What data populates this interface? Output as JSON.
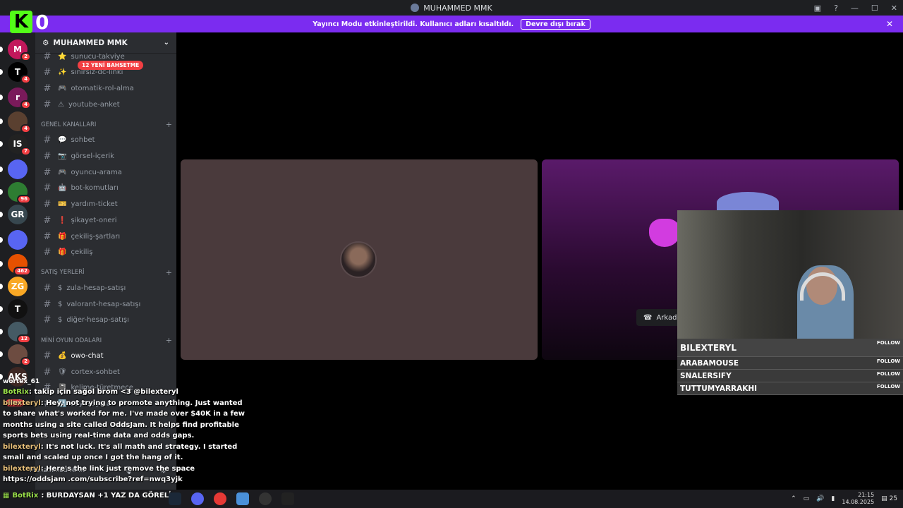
{
  "window": {
    "title": "MUHAMMED MMK"
  },
  "logo": {
    "letter": "K",
    "counter": "0"
  },
  "banner": {
    "message": "Yayıncı Modu etkinleştirildi. Kullanıcı adları kısaltıldı.",
    "button": "Devre dışı bırak"
  },
  "guilds": [
    {
      "label": "M",
      "badge": "2",
      "color": "#c2185b"
    },
    {
      "label": "T",
      "badge": "4",
      "color": "#000000"
    },
    {
      "label": "r",
      "badge": "4",
      "color": "#7a1a5a"
    },
    {
      "label": "",
      "badge": "4",
      "color": "#5a4030"
    },
    {
      "label": "IS",
      "badge": "7",
      "color": "#222222"
    },
    {
      "label": "",
      "badge": "",
      "color": "#5865f2"
    },
    {
      "label": "",
      "badge": "96",
      "color": "#2e7d32"
    },
    {
      "label": "GR",
      "badge": "",
      "color": "#37474f"
    },
    {
      "label": "",
      "badge": "",
      "color": "#5865f2"
    },
    {
      "label": "",
      "badge": "462",
      "color": "#e65100"
    },
    {
      "label": "ZG",
      "badge": "",
      "color": "#f9a825"
    },
    {
      "label": "T",
      "badge": "",
      "color": "#111111"
    },
    {
      "label": "",
      "badge": "12",
      "color": "#455a64"
    },
    {
      "label": "",
      "badge": "2",
      "color": "#6d4c41"
    },
    {
      "label": "AKS",
      "badge": "",
      "color": "#3e2723"
    }
  ],
  "server": {
    "name": "MUHAMMED MMK"
  },
  "new_pill": "12 YENİ BAHSETME",
  "channels": [
    {
      "type": "ch",
      "name": "sunucu-takviye",
      "emoji": "⭐"
    },
    {
      "type": "ch",
      "name": "sınırsız-dc-linki",
      "emoji": "✨"
    },
    {
      "type": "ch",
      "name": "otomatik-rol-alma",
      "emoji": "🎮"
    },
    {
      "type": "ch",
      "name": "youtube-anket",
      "emoji": "⚠"
    },
    {
      "type": "cat",
      "name": "GENEL KANALLARI"
    },
    {
      "type": "ch",
      "name": "sohbet",
      "emoji": "💬"
    },
    {
      "type": "ch",
      "name": "görsel-içerik",
      "emoji": "📷"
    },
    {
      "type": "ch",
      "name": "oyuncu-arama",
      "emoji": "🎮"
    },
    {
      "type": "ch",
      "name": "bot-komutları",
      "emoji": "🤖"
    },
    {
      "type": "ch",
      "name": "yardım-ticket",
      "emoji": "🎫"
    },
    {
      "type": "ch",
      "name": "şikayet-oneri",
      "emoji": "❗"
    },
    {
      "type": "ch",
      "name": "çekiliş-şartları",
      "emoji": "🎁"
    },
    {
      "type": "ch",
      "name": "çekiliş",
      "emoji": "🎁"
    },
    {
      "type": "cat",
      "name": "SATIŞ YERLERİ"
    },
    {
      "type": "ch",
      "name": "zula-hesap-satışı",
      "emoji": "$"
    },
    {
      "type": "ch",
      "name": "valorant-hesap-satışı",
      "emoji": "$"
    },
    {
      "type": "ch",
      "name": "diğer-hesap-satışı",
      "emoji": "$"
    },
    {
      "type": "cat",
      "name": "MİNİ OYUN ODALARI"
    },
    {
      "type": "ch",
      "name": "owo-chat",
      "emoji": "💰",
      "active": true
    },
    {
      "type": "ch",
      "name": "cortex-sohbet",
      "emoji": "🛡"
    },
    {
      "type": "ch",
      "name": "kelime-türetmece",
      "emoji": "📓"
    },
    {
      "type": "ch",
      "name": "sayı-sayma",
      "emoji": "🔢"
    }
  ],
  "voice_tile": {
    "button": "Arkada"
  },
  "follows": [
    {
      "name": "BILEXTERYL",
      "tag": "FOLLOW"
    },
    {
      "name": "ARABAMOUSE",
      "tag": "FOLLOW"
    },
    {
      "name": "SNALERSIFY",
      "tag": "FOLLOW"
    },
    {
      "name": "TUTTUMYARRAKHI",
      "tag": "FOLLOW"
    }
  ],
  "overlay": {
    "wortex": "wortex_61",
    "yeni": "YENİ",
    "username": "Muhammed MMK"
  },
  "chat": [
    {
      "user": "BotRix",
      "cls": "u-bot",
      "text": ": takip için sağol brom <3 @bilexteryl"
    },
    {
      "user": "bilexteryl",
      "cls": "u-b",
      "text": ": Hey, not trying to promote anything. Just wanted to share what's worked for me. I've made over $40K in a few months using a site called OddsJam. It helps find profitable sports bets using real-time data and odds gaps."
    },
    {
      "user": "bilexteryl",
      "cls": "u-b",
      "text": ": It's not luck. It's all math and strategy. I started small and scaled up once I got the hang of it."
    },
    {
      "user": "bilexteryl",
      "cls": "u-b",
      "text": ": Here's the link just remove the space https://oddsjam .com/subscribe?ref=nwq3yjk"
    }
  ],
  "taskbar": {
    "bot_user": "BotRix",
    "bot_text": ": BURDAYSAN +1 YAZ DA GÖRELİM",
    "time": "21:15",
    "date": "14.08.2025",
    "notif": "25"
  }
}
